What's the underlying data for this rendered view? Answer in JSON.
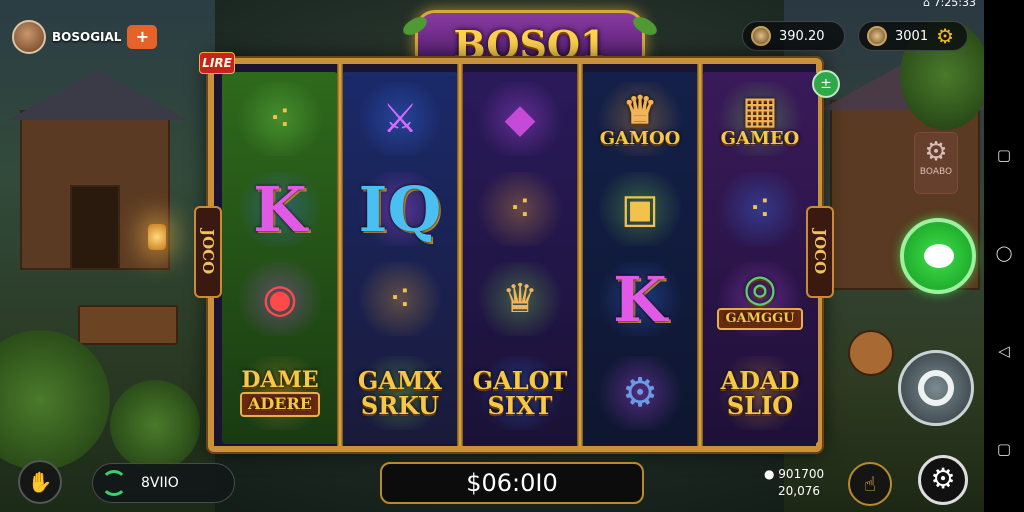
{
  "status_bar": {
    "text": "⌂ 7:25:33"
  },
  "player": {
    "name": "BOSOGIAL",
    "plus_label": "+"
  },
  "top_right": {
    "coins_value": "390.20",
    "gems_value": "3001"
  },
  "game_logo": {
    "title": "BOSO1"
  },
  "tags": {
    "top_left_badge": "LIRE",
    "mini_button": "±"
  },
  "side_labels": {
    "left": "JOCO",
    "right": "JOCO"
  },
  "reels": [
    {
      "symbols": [
        {
          "type": "icon",
          "name": "golden-scroll",
          "glyph": "⁖"
        },
        {
          "type": "letter",
          "text": "K"
        },
        {
          "type": "icon",
          "name": "lantern-gem",
          "glyph": "◉"
        },
        {
          "type": "plate",
          "line1": "DAME",
          "line2": "ADERE"
        }
      ]
    },
    {
      "symbols": [
        {
          "type": "icon",
          "name": "purple-sword",
          "glyph": "⚔"
        },
        {
          "type": "letter",
          "text": "IQ"
        },
        {
          "type": "icon",
          "name": "golden-scroll",
          "glyph": "⁖"
        },
        {
          "type": "words",
          "line1": "GAMX",
          "line2": "SRKU"
        }
      ]
    },
    {
      "symbols": [
        {
          "type": "icon",
          "name": "purple-gem",
          "glyph": "◆"
        },
        {
          "type": "icon",
          "name": "golden-scroll",
          "glyph": "⁖"
        },
        {
          "type": "icon",
          "name": "queen-portrait",
          "glyph": "♛"
        },
        {
          "type": "words",
          "line1": "GALOT",
          "line2": "SIXT"
        }
      ]
    },
    {
      "symbols": [
        {
          "type": "words_icon",
          "glyph": "♛",
          "text": "GAMOO"
        },
        {
          "type": "icon",
          "name": "golden-chest",
          "glyph": "▣"
        },
        {
          "type": "letter",
          "text": "K"
        },
        {
          "type": "icon",
          "name": "blue-gem-gear",
          "glyph": "⚙"
        }
      ]
    },
    {
      "symbols": [
        {
          "type": "words_icon",
          "glyph": "▦",
          "text": "GAMEO"
        },
        {
          "type": "icon",
          "name": "golden-scroll",
          "glyph": "⁖"
        },
        {
          "type": "plate_icon",
          "glyph": "◎",
          "text": "GAMGGU"
        },
        {
          "type": "words",
          "line1": "ADAD",
          "line2": "SLIO"
        }
      ]
    }
  ],
  "sign": {
    "label": "BOABO"
  },
  "bottom": {
    "bet_value": "8VIIO",
    "balance": "$06:0I0",
    "win_line1": "901700",
    "win_line2": "20,076"
  },
  "colors": {
    "accent_gold": "#c9923a",
    "chat_green": "#2fcc3a",
    "plus_orange": "#e5622a"
  }
}
